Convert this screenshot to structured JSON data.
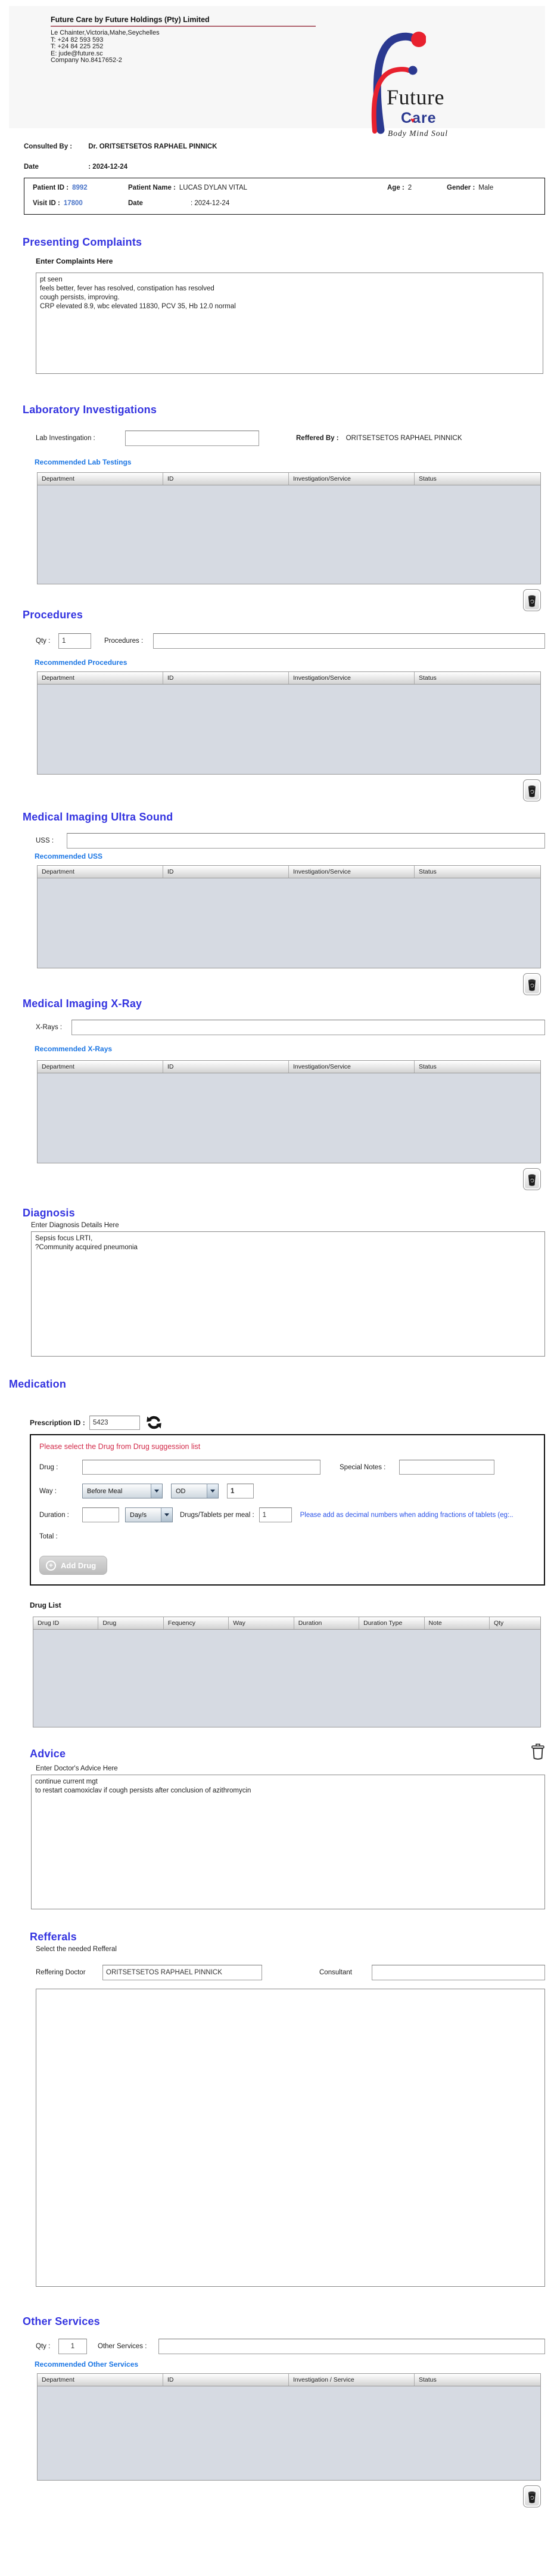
{
  "header": {
    "company_name": "Future Care by Future Holdings (Pty) Limited",
    "address": "Le Chainter,Victoria,Mahe,Seychelles",
    "phone1": "T: +24  82 593 593",
    "phone2": "T: +24  84 225 252",
    "email": "E: jude@future.sc",
    "company_no": "Company No.8417652-2",
    "logo": {
      "word1": "Future",
      "word2": "Care",
      "heart": "♥",
      "tagline": "Body Mind Soul"
    }
  },
  "consult": {
    "consulted_by_label": "Consulted By :",
    "consulted_by_value": "Dr.  ORITSETSETOS RAPHAEL PINNICK",
    "date_label": "Date",
    "date_value": ":  2024-12-24"
  },
  "patient": {
    "patient_id_label": "Patient ID :",
    "patient_id": "8992",
    "patient_name_label": "Patient Name :",
    "patient_name": "LUCAS DYLAN VITAL",
    "age_label": "Age :",
    "age": "2",
    "gender_label": "Gender :",
    "gender": "Male",
    "visit_id_label": "Visit ID :",
    "visit_id": "17800",
    "visit_date_label": "Date",
    "visit_date": ":  2024-12-24"
  },
  "complaints": {
    "heading": "Presenting Complaints",
    "label": "Enter Complaints Here",
    "text": "pt seen\nfeels better, fever has resolved, constipation has resolved\ncough persists, improving.\nCRP elevated 8.9, wbc elevated 11830, PCV 35, Hb 12.0 normal"
  },
  "lab": {
    "heading": "Laboratory  Investigations",
    "field_label": "Lab Investingation :",
    "field_value": "",
    "reffered_label": "Reffered By :",
    "reffered_value": "ORITSETSETOS RAPHAEL PINNICK",
    "link": "Recommended Lab Testings",
    "headers": [
      "Department",
      "ID",
      "Investigation/Service",
      "Status"
    ]
  },
  "procedures": {
    "heading": "Procedures",
    "qty_label": "Qty :",
    "qty": "1",
    "field_label": "Procedures :",
    "field_value": "",
    "link": "Recommended Procedures",
    "headers": [
      "Department",
      "ID",
      "Investigation/Service",
      "Status"
    ]
  },
  "uss": {
    "heading": "Medical Imaging Ultra Sound",
    "field_label": "USS :",
    "field_value": "",
    "link": "Recommended USS",
    "headers": [
      "Department",
      "ID",
      "Investigation/Service",
      "Status"
    ]
  },
  "xray": {
    "heading": "Medical Imaging X-Ray",
    "field_label": "X-Rays :",
    "field_value": "",
    "link": "Recommended X-Rays",
    "headers": [
      "Department",
      "ID",
      "Investigation/Service",
      "Status"
    ]
  },
  "diagnosis": {
    "heading": "Diagnosis",
    "label": "Enter Diagnosis Details Here",
    "text": "Sepsis focus LRTI,\n?Community acquired pneumonia"
  },
  "medication": {
    "heading": "Medication",
    "prescription_id_label": "Prescription ID :",
    "prescription_id": "5423",
    "warning": "Please select the Drug from Drug suggession list",
    "drug_label": "Drug :",
    "drug_value": "",
    "special_notes_label": "Special Notes :",
    "special_notes_value": "",
    "way_label": "Way :",
    "way_option": "Before Meal",
    "frequency_option": "OD",
    "way_qty": "1",
    "duration_label": "Duration :",
    "duration_value": "",
    "duration_type_option": "Day/s",
    "per_meal_label": "Drugs/Tablets per meal :",
    "per_meal_value": "1",
    "fraction_note": "Please add as decimal numbers when adding fractions of tablets (eg:..",
    "total_label": "Total :",
    "add_drug_label": "Add Drug",
    "drug_list_label": "Drug List",
    "drug_headers": [
      "Drug ID",
      "Drug",
      "Fequency",
      "Way",
      "Duration",
      "Duration Type",
      "Note",
      "Qty"
    ]
  },
  "advice": {
    "heading": "Advice",
    "label": "Enter Doctor's Advice Here",
    "text": "continue current mgt\nto restart coamoxiclav if cough persists after conclusion of azithromycin"
  },
  "refferals": {
    "heading": "Refferals",
    "sublabel": "Select the needed Refferal",
    "doctor_label": "Reffering Doctor",
    "doctor_value": "ORITSETSETOS RAPHAEL PINNICK",
    "consultant_label": "Consultant",
    "consultant_value": ""
  },
  "other_services": {
    "heading": "Other Services",
    "qty_label": "Qty :",
    "qty": "1",
    "field_label": "Other Services :",
    "field_value": "",
    "link": "Recommended Other Services",
    "headers": [
      "Department",
      "ID",
      "Investigation / Service",
      "Status"
    ]
  },
  "icons": {
    "delete": "trash-icon",
    "delete_outline": "trash-outline-icon",
    "refresh": "refresh-icon",
    "add": "plus-circle-icon",
    "dropdown": "chevron-down-icon"
  },
  "colors": {
    "heading_blue": "#3434e0",
    "link_blue": "#1b76e4",
    "warning_red": "#d22b4a",
    "note_blue": "#2a52e8",
    "id_blue": "#4a74c8",
    "logo_blue": "#2b3990",
    "logo_red": "#e8212e",
    "table_body": "#d6dae2"
  }
}
